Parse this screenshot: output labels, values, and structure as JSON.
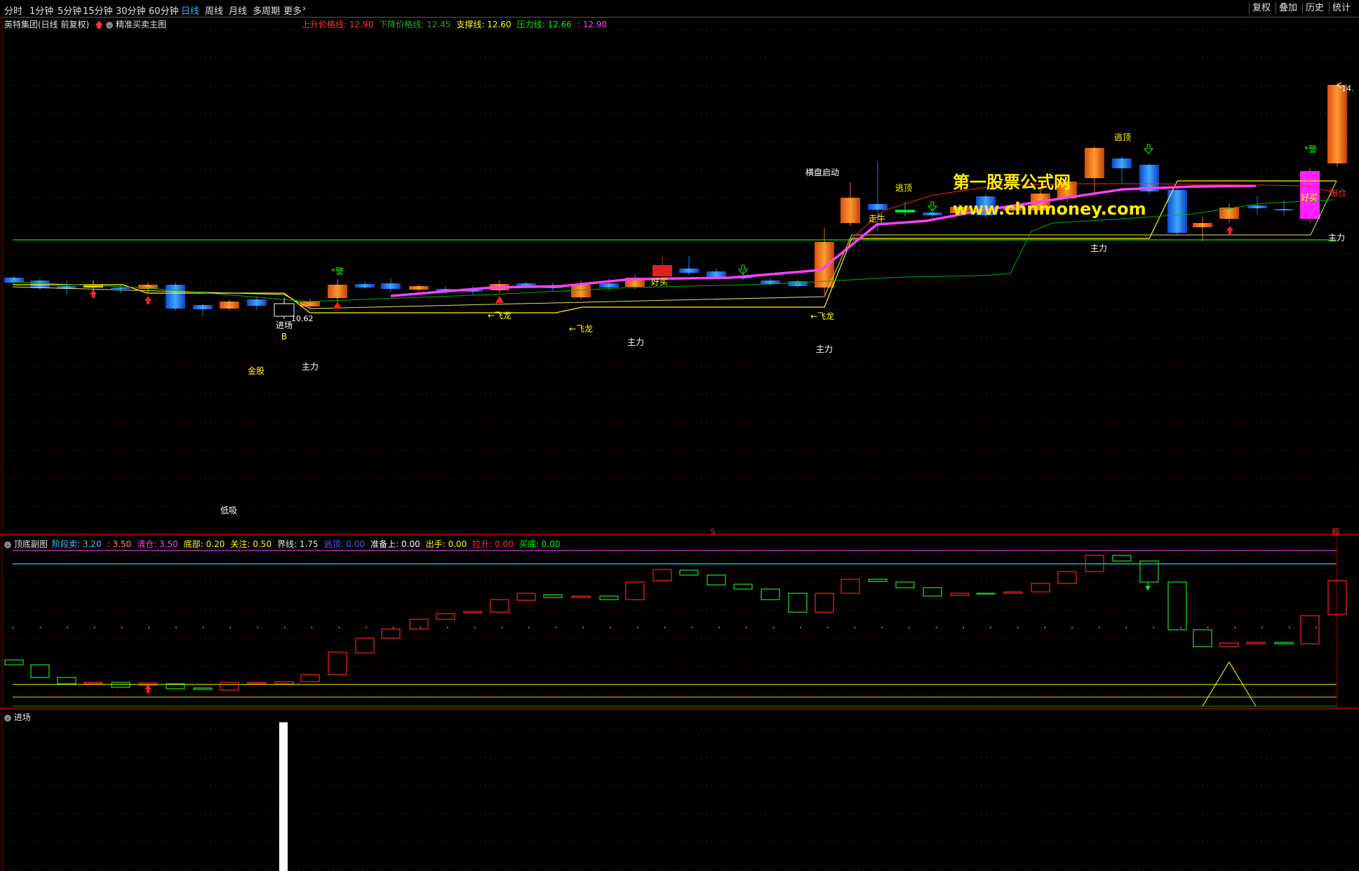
{
  "toolbar": {
    "periods": [
      {
        "label": "分时",
        "active": false
      },
      {
        "label": "1分钟",
        "active": false
      },
      {
        "label": "5分钟",
        "active": false
      },
      {
        "label": "15分钟",
        "active": false
      },
      {
        "label": "30分钟",
        "active": false
      },
      {
        "label": "60分钟",
        "active": false
      },
      {
        "label": "日线",
        "active": true
      },
      {
        "label": "周线",
        "active": false
      },
      {
        "label": "月线",
        "active": false
      },
      {
        "label": "多周期",
        "active": false
      },
      {
        "label": "更多",
        "active": false
      }
    ],
    "right": [
      "复权",
      "叠加",
      "历史",
      "统计"
    ]
  },
  "main_panel": {
    "title": "英特集团(日线 前复权)",
    "formula": "精准买卖主图",
    "indicators": [
      {
        "name": "上升价格线:",
        "value": "12.90",
        "color": "#ff3333"
      },
      {
        "name": "下降价格线:",
        "value": "12.45",
        "color": "#22aa22"
      },
      {
        "name": "支撑线:",
        "value": "12.60",
        "color": "#ffff00"
      },
      {
        "name": "压力线:",
        "value": "12.66",
        "color": "#00ee00"
      },
      {
        "name": ":",
        "value": "12.90",
        "color": "#ff40ff"
      }
    ],
    "watermark_title": "第一股票公式网",
    "watermark_url": "www.chnmoney.com",
    "price_low": "10.62",
    "price_high": "14.",
    "labels": [
      {
        "text": "*警",
        "color": "#00ff00"
      },
      {
        "text": "进场",
        "color": "#ffffff"
      },
      {
        "text": "B",
        "color": "#ffff00"
      },
      {
        "text": "金股",
        "color": "#ffff00"
      },
      {
        "text": "主力",
        "color": "#ffffff"
      },
      {
        "text": "←飞龙",
        "color": "#ffff00"
      },
      {
        "text": "←飞龙",
        "color": "#ffff00"
      },
      {
        "text": "主力",
        "color": "#ffffff"
      },
      {
        "text": "好买",
        "color": "#ffff00"
      },
      {
        "text": "横盘启动",
        "color": "#ffffff"
      },
      {
        "text": "←飞龙",
        "color": "#ffff00"
      },
      {
        "text": "主力",
        "color": "#ffffff"
      },
      {
        "text": "走牛",
        "color": "#ffff00"
      },
      {
        "text": "逃顶",
        "color": "#ffff00"
      },
      {
        "text": "逃顶",
        "color": "#ffff00"
      },
      {
        "text": "主力",
        "color": "#ffffff"
      },
      {
        "text": "*警",
        "color": "#00ff00"
      },
      {
        "text": "好买",
        "color": "#ffff00"
      },
      {
        "text": "加仓",
        "color": "#ff3333"
      },
      {
        "text": "主力",
        "color": "#ffffff"
      },
      {
        "text": "低吸",
        "color": "#ffffff"
      },
      {
        "text": "S",
        "color": "#ff3333"
      },
      {
        "text": "稳",
        "color": "#ff3333"
      }
    ]
  },
  "sub_panel": {
    "title": "顶底副图",
    "indicators": [
      {
        "name": "阶段卖:",
        "value": "3.20",
        "color": "#40c0ff"
      },
      {
        "name": ":",
        "value": "3.50",
        "color": "#ff9933"
      },
      {
        "name": "清仓:",
        "value": "3.50",
        "color": "#ff40ff"
      },
      {
        "name": "底部:",
        "value": "0.20",
        "color": "#ffff00"
      },
      {
        "name": "关注:",
        "value": "0.50",
        "color": "#ffff00"
      },
      {
        "name": "界线:",
        "value": "1.75",
        "color": "#c8ffc8"
      },
      {
        "name": "逃顶:",
        "value": "0.00",
        "color": "#4060ff"
      },
      {
        "name": "准备上:",
        "value": "0.00",
        "color": "#ffffff"
      },
      {
        "name": "出手:",
        "value": "0.00",
        "color": "#ffff00"
      },
      {
        "name": "拉升:",
        "value": "0.00",
        "color": "#ff3333"
      },
      {
        "name": "买底:",
        "value": "0.00",
        "color": "#00ff00"
      }
    ]
  },
  "third_panel": {
    "title": "进场"
  },
  "colors": {
    "up": "#ff3232",
    "down": "#00ffff",
    "grid": "#8b0000",
    "bg": "#000000"
  },
  "icons": [
    "red-up-arrow-icon",
    "collapse-circle-icon",
    "chevron-right-icon",
    "green-down-arrow-icon"
  ]
}
